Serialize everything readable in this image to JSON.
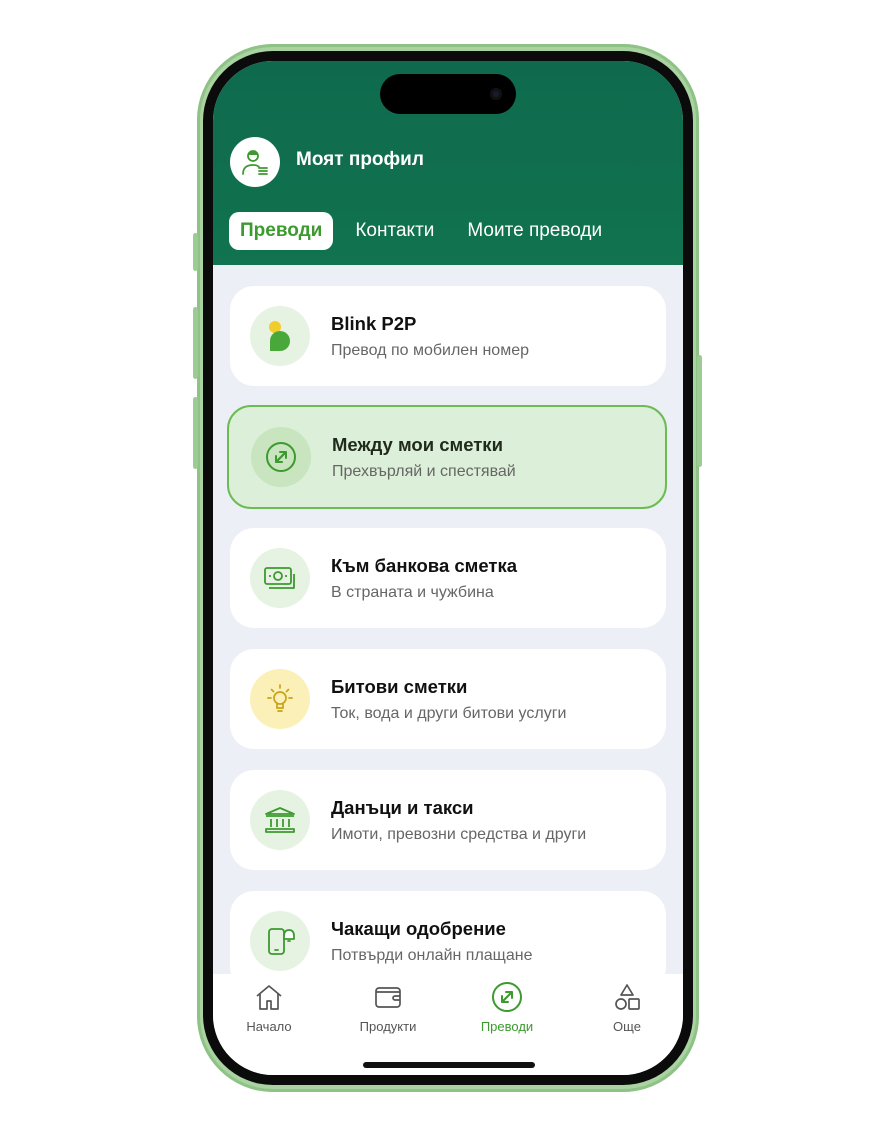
{
  "header": {
    "profile_title": "Моят профил"
  },
  "tabs": [
    {
      "label": "Преводи",
      "active": true
    },
    {
      "label": "Контакти",
      "active": false
    },
    {
      "label": "Моите преводи",
      "active": false
    }
  ],
  "cards": [
    {
      "title": "Blink P2P",
      "subtitle": "Превод по мобилен номер",
      "icon": "blink-p2p-icon"
    },
    {
      "title": "Между мои сметки",
      "subtitle": "Прехвърляй и спестявай",
      "icon": "transfer-arrows-icon",
      "selected": true
    },
    {
      "title": "Към банкова сметка",
      "subtitle": "В страната и чужбина",
      "icon": "banknotes-icon"
    },
    {
      "title": "Битови сметки",
      "subtitle": "Ток, вода и други битови услуги",
      "icon": "lightbulb-icon"
    },
    {
      "title": "Данъци и такси",
      "subtitle": "Имоти, превозни средства и други",
      "icon": "bank-building-icon"
    },
    {
      "title": "Чакащи одобрение",
      "subtitle": "Потвърди онлайн плащане",
      "icon": "phone-bell-icon"
    }
  ],
  "bottom_nav": [
    {
      "label": "Начало",
      "icon": "home-icon",
      "active": false
    },
    {
      "label": "Продукти",
      "icon": "wallet-icon",
      "active": false
    },
    {
      "label": "Преводи",
      "icon": "transfer-icon",
      "active": true
    },
    {
      "label": "Още",
      "icon": "shapes-icon",
      "active": false
    }
  ],
  "colors": {
    "header_green": "#11734f",
    "accent_green": "#3c9a2f",
    "selected_card_bg": "#dcefd8",
    "screen_bg": "#eceff6"
  }
}
